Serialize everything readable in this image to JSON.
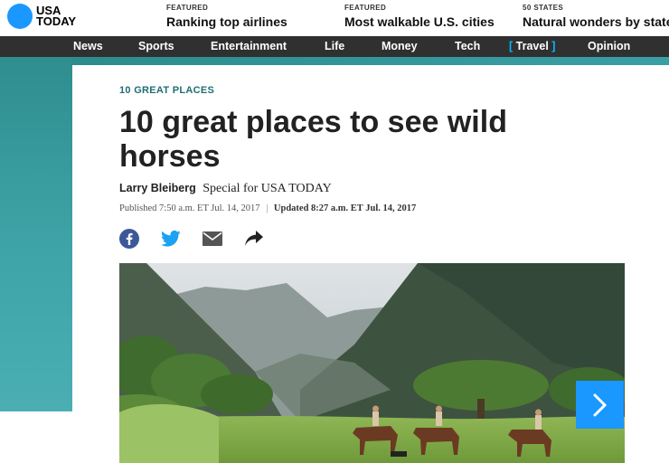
{
  "brand": {
    "line1": "USA",
    "line2": "TODAY",
    "color": "#1a98ff"
  },
  "promos": [
    {
      "kicker": "FEATURED",
      "title": "Ranking top airlines"
    },
    {
      "kicker": "FEATURED",
      "title": "Most walkable U.S. cities"
    },
    {
      "kicker": "50 STATES",
      "title": "Natural wonders by state"
    }
  ],
  "nav": {
    "items": [
      "News",
      "Sports",
      "Entertainment",
      "Life",
      "Money",
      "Tech",
      "Travel",
      "Opinion"
    ],
    "active": "Travel",
    "bracket_open": "[",
    "bracket_close": "]"
  },
  "article": {
    "kicker": "10 GREAT PLACES",
    "headline": "10 great places to see wild horses",
    "author": "Larry Bleiberg",
    "author_desc": "Special for USA TODAY",
    "published": "Published 7:50 a.m. ET Jul. 14, 2017",
    "separator": "|",
    "updated": "Updated 8:27 a.m. ET Jul. 14, 2017"
  },
  "share": [
    "facebook-icon",
    "twitter-icon",
    "email-icon",
    "share-arrow-icon"
  ],
  "colors": {
    "nav_bg": "#303030",
    "teal": "#3a9fa5",
    "facebook": "#3b5998",
    "twitter": "#1da1f2"
  }
}
